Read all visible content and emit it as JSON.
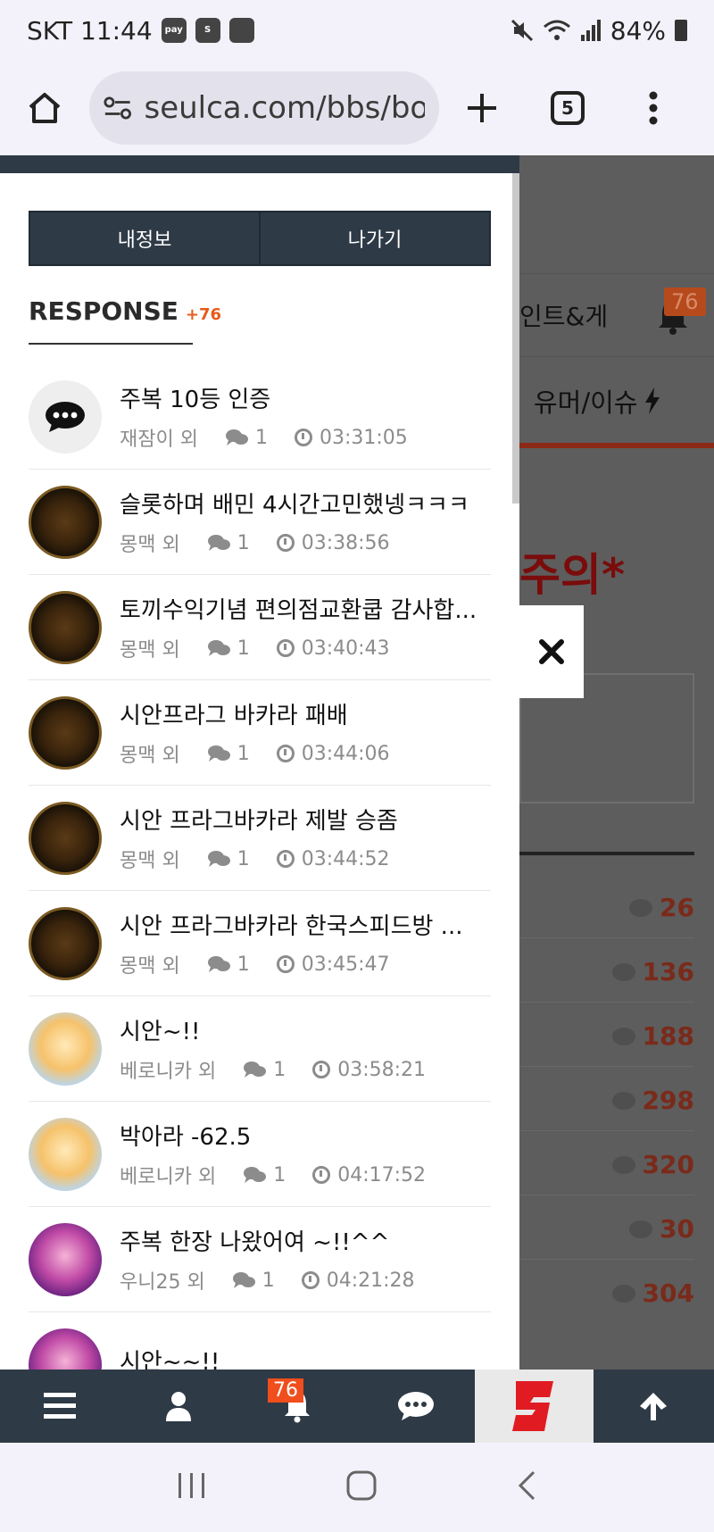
{
  "status_bar": {
    "time": "SKT 11:44",
    "battery": "84%",
    "icons": [
      "pay-icon",
      "s-icon",
      "gallery-icon",
      "mute-icon",
      "wifi-icon",
      "signal-icon",
      "battery-icon"
    ]
  },
  "browser": {
    "url": "seulca.com/bbs/boa",
    "tab_count": "5"
  },
  "drawer": {
    "tabs": [
      "내정보",
      "나가기"
    ],
    "response_title": "RESPONSE",
    "response_count": "+76",
    "items": [
      {
        "title": "주복 10등 인증",
        "user": "재잠이 외",
        "count": "1",
        "time": "03:31:05",
        "avatar": "chat"
      },
      {
        "title": "슬롯하며 배민 4시간고민했넹ㅋㅋㅋ",
        "user": "몽맥 외",
        "count": "1",
        "time": "03:38:56",
        "avatar": "play"
      },
      {
        "title": "토끼수익기념 편의점교환쿱 감사합...",
        "user": "몽맥 외",
        "count": "1",
        "time": "03:40:43",
        "avatar": "play"
      },
      {
        "title": "시안프라그 바카라 패배",
        "user": "몽맥 외",
        "count": "1",
        "time": "03:44:06",
        "avatar": "play"
      },
      {
        "title": "시안 프라그바카라 제발 승좀",
        "user": "몽맥 외",
        "count": "1",
        "time": "03:44:52",
        "avatar": "play"
      },
      {
        "title": "시안 프라그바카라 한국스피드방 ...",
        "user": "몽맥 외",
        "count": "1",
        "time": "03:45:47",
        "avatar": "play"
      },
      {
        "title": "시안~!!",
        "user": "베로니카 외",
        "count": "1",
        "time": "03:58:21",
        "avatar": "tiger"
      },
      {
        "title": "박아라 -62.5",
        "user": "베로니카 외",
        "count": "1",
        "time": "04:17:52",
        "avatar": "tiger"
      },
      {
        "title": "주복 한장 나왔어여 ~!!^^",
        "user": "우니25 외",
        "count": "1",
        "time": "04:21:28",
        "avatar": "queen"
      },
      {
        "title": "시안~~!!",
        "user": "",
        "count": "",
        "time": "",
        "avatar": "queen"
      }
    ]
  },
  "background_page": {
    "tab_partial": "인트&게",
    "bell_badge": "76",
    "category": "유머/이슈",
    "warning_partial": "주의*",
    "comment_counts": [
      "26",
      "136",
      "188",
      "298",
      "320",
      "30",
      "304"
    ]
  },
  "toolbar": {
    "notification_badge": "76"
  },
  "colors": {
    "dark": "#2e3a46",
    "accent": "#e85a1b",
    "badge": "#f04e1c"
  }
}
